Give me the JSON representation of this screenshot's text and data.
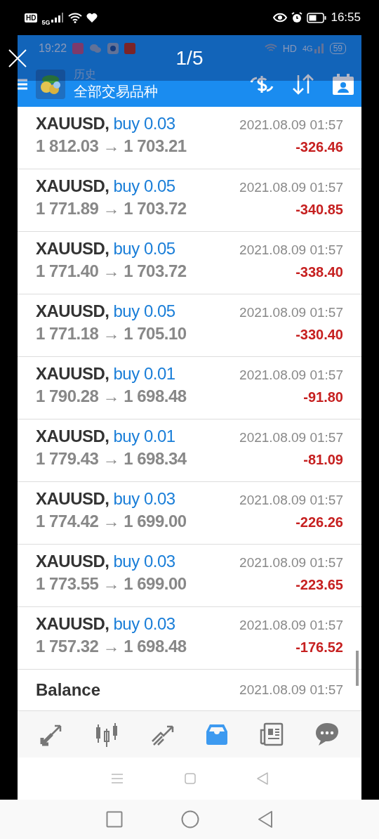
{
  "status_bar": {
    "hd": "HD",
    "network": "5G",
    "time": "16:55"
  },
  "viewer": {
    "counter": "1/5"
  },
  "app_status_bar": {
    "time": "19:22",
    "hd": "HD",
    "network": "4G",
    "battery": "59"
  },
  "toolbar": {
    "title": "历史",
    "subtitle": "全部交易品种"
  },
  "trades": [
    {
      "symbol": "XAUUSD,",
      "order": "buy 0.03",
      "time": "2021.08.09 01:57",
      "prices": "1 812.03 → 1 703.21",
      "profit": "-326.46"
    },
    {
      "symbol": "XAUUSD,",
      "order": "buy 0.05",
      "time": "2021.08.09 01:57",
      "prices": "1 771.89 → 1 703.72",
      "profit": "-340.85"
    },
    {
      "symbol": "XAUUSD,",
      "order": "buy 0.05",
      "time": "2021.08.09 01:57",
      "prices": "1 771.40 → 1 703.72",
      "profit": "-338.40"
    },
    {
      "symbol": "XAUUSD,",
      "order": "buy 0.05",
      "time": "2021.08.09 01:57",
      "prices": "1 771.18 → 1 705.10",
      "profit": "-330.40"
    },
    {
      "symbol": "XAUUSD,",
      "order": "buy 0.01",
      "time": "2021.08.09 01:57",
      "prices": "1 790.28 → 1 698.48",
      "profit": "-91.80"
    },
    {
      "symbol": "XAUUSD,",
      "order": "buy 0.01",
      "time": "2021.08.09 01:57",
      "prices": "1 779.43 → 1 698.34",
      "profit": "-81.09"
    },
    {
      "symbol": "XAUUSD,",
      "order": "buy 0.03",
      "time": "2021.08.09 01:57",
      "prices": "1 774.42 → 1 699.00",
      "profit": "-226.26"
    },
    {
      "symbol": "XAUUSD,",
      "order": "buy 0.03",
      "time": "2021.08.09 01:57",
      "prices": "1 773.55 → 1 699.00",
      "profit": "-223.65"
    },
    {
      "symbol": "XAUUSD,",
      "order": "buy 0.03",
      "time": "2021.08.09 01:57",
      "prices": "1 757.32 → 1 698.48",
      "profit": "-176.52"
    }
  ],
  "balance": {
    "label": "Balance",
    "time": "2021.08.09 01:57"
  },
  "bottom_tabs": [
    {
      "kind": "quotes",
      "selected": false
    },
    {
      "kind": "chart",
      "selected": false
    },
    {
      "kind": "trade",
      "selected": false
    },
    {
      "kind": "history",
      "selected": true
    },
    {
      "kind": "news",
      "selected": false
    },
    {
      "kind": "chat",
      "selected": false
    }
  ]
}
